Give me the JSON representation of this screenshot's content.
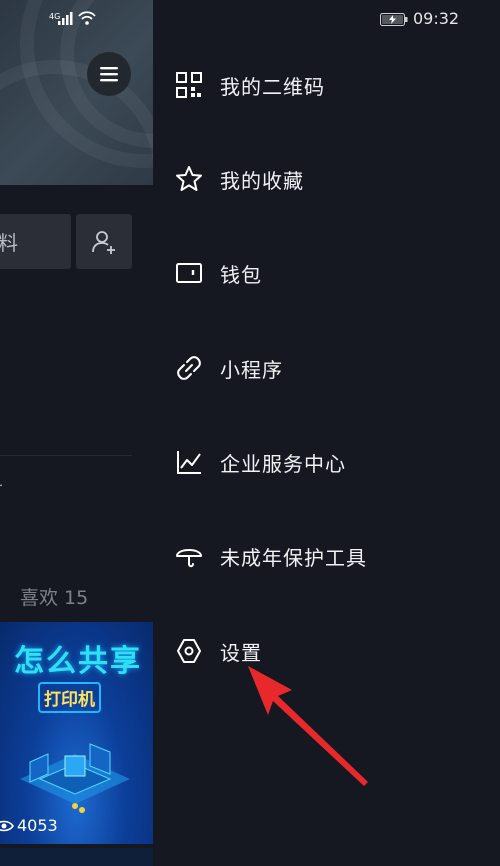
{
  "status_bar": {
    "network": "4G",
    "time": "09:32"
  },
  "background_page": {
    "edit_profile_fragment": "料",
    "stray_text": "-",
    "likes_tab": {
      "label": "喜欢",
      "count": "15"
    },
    "video": {
      "title": "怎么共享",
      "subtitle": "打印机",
      "views": "4053"
    }
  },
  "drawer": {
    "items": [
      {
        "label": "我的二维码",
        "icon": "qr-code-icon"
      },
      {
        "label": "我的收藏",
        "icon": "star-icon"
      },
      {
        "label": "钱包",
        "icon": "wallet-icon"
      },
      {
        "label": "小程序",
        "icon": "link-icon"
      },
      {
        "label": "企业服务中心",
        "icon": "line-chart-icon"
      },
      {
        "label": "未成年保护工具",
        "icon": "umbrella-icon"
      },
      {
        "label": "设置",
        "icon": "hexagon-gear-icon"
      }
    ]
  },
  "annotation": {
    "arrow_color": "#e8292b",
    "points_to": "设置"
  }
}
